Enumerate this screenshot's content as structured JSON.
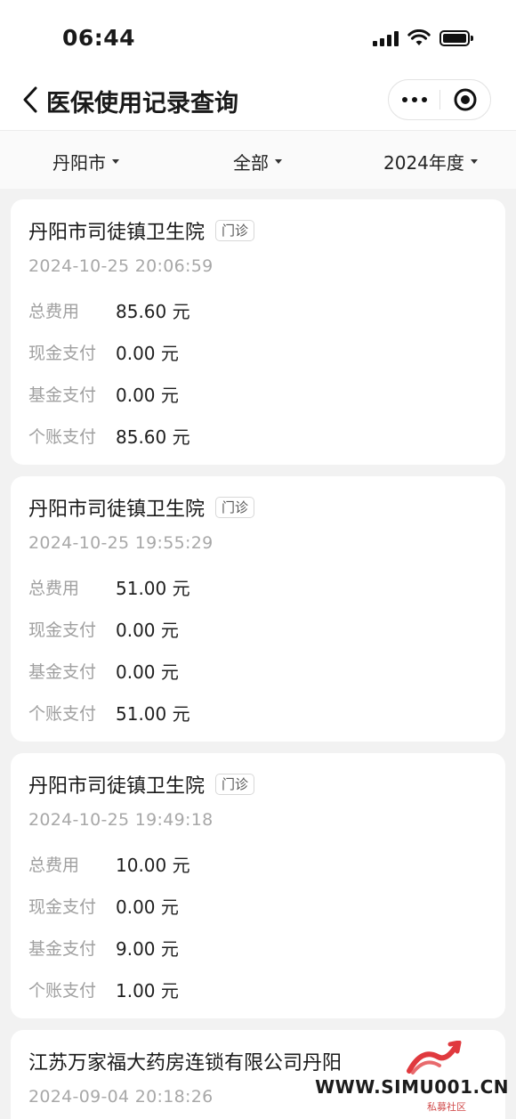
{
  "status_bar": {
    "time": "06:44"
  },
  "nav": {
    "title": "医保使用记录查询"
  },
  "filters": [
    {
      "label": "丹阳市"
    },
    {
      "label": "全部"
    },
    {
      "label": "2024年度"
    }
  ],
  "records": [
    {
      "hospital": "丹阳市司徒镇卫生院",
      "tag": "门诊",
      "datetime": "2024-10-25 20:06:59",
      "rows": [
        {
          "label": "总费用",
          "value": "85.60 元"
        },
        {
          "label": "现金支付",
          "value": "0.00 元"
        },
        {
          "label": "基金支付",
          "value": "0.00 元"
        },
        {
          "label": "个账支付",
          "value": "85.60 元"
        }
      ]
    },
    {
      "hospital": "丹阳市司徒镇卫生院",
      "tag": "门诊",
      "datetime": "2024-10-25 19:55:29",
      "rows": [
        {
          "label": "总费用",
          "value": "51.00 元"
        },
        {
          "label": "现金支付",
          "value": "0.00 元"
        },
        {
          "label": "基金支付",
          "value": "0.00 元"
        },
        {
          "label": "个账支付",
          "value": "51.00 元"
        }
      ]
    },
    {
      "hospital": "丹阳市司徒镇卫生院",
      "tag": "门诊",
      "datetime": "2024-10-25 19:49:18",
      "rows": [
        {
          "label": "总费用",
          "value": "10.00 元"
        },
        {
          "label": "现金支付",
          "value": "0.00 元"
        },
        {
          "label": "基金支付",
          "value": "9.00 元"
        },
        {
          "label": "个账支付",
          "value": "1.00 元"
        }
      ]
    },
    {
      "hospital": "江苏万家福大药房连锁有限公司丹阳",
      "datetime": "2024-09-04 20:18:26"
    }
  ],
  "watermark": {
    "text": "WWW.SIMU001.CN",
    "sub": "私募社区"
  },
  "colors": {
    "accent_red": "#e0393e",
    "muted_text": "#a0a0a0",
    "background": "#f2f2f2"
  }
}
